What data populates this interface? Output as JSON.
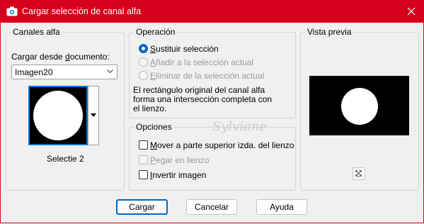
{
  "window": {
    "title": "Cargar selección de canal alfa",
    "close_icon": "close-icon",
    "app_icon": "camera-icon",
    "accent": "#d6001c"
  },
  "canales": {
    "group_label": "Canales alfa",
    "load_from_prefix": "Cargar desde ",
    "load_from_underlined": "d",
    "load_from_suffix": "ocumento:",
    "document_value": "Imagen20",
    "channel_name": "Selectie 2"
  },
  "operacion": {
    "group_label": "Operación",
    "options": [
      {
        "acc": "S",
        "rest": "ustituir selección",
        "checked": true,
        "disabled": false
      },
      {
        "acc": "A",
        "rest": "ñadir a la selección actual",
        "checked": false,
        "disabled": true
      },
      {
        "acc": "E",
        "rest": "liminar de la selección actual",
        "checked": false,
        "disabled": true
      }
    ],
    "info_lines": [
      "El rectángulo original del canal alfa",
      "forma una intersección completa con",
      "el lienzo."
    ]
  },
  "opciones": {
    "group_label": "Opciones",
    "items": [
      {
        "acc": "M",
        "rest": "over a parte superior izda. del lienzo",
        "checked": false,
        "disabled": false
      },
      {
        "acc": "P",
        "rest": "egar en lienzo",
        "checked": false,
        "disabled": true
      },
      {
        "acc": "I",
        "rest": "nvertir imagen",
        "checked": false,
        "disabled": false
      }
    ]
  },
  "preview": {
    "group_label": "Vista previa",
    "zoom_icon": "checkerboard-zoom-icon"
  },
  "buttons": {
    "ok": "Cargar",
    "cancel": "Cancelar",
    "help": "Ayuda"
  },
  "watermark": "Sylviane"
}
